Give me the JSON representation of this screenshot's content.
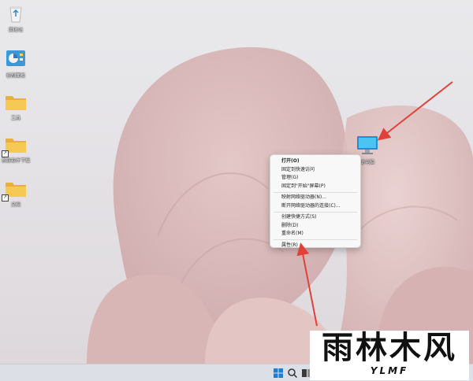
{
  "desktop": {
    "icons": [
      {
        "label": "回收站",
        "icon": "recycle-bin-icon"
      },
      {
        "label": "控制面板",
        "icon": "control-panel-icon"
      },
      {
        "label": "工具",
        "icon": "folder-icon"
      },
      {
        "label": "系统软件下载",
        "icon": "folder-icon"
      },
      {
        "label": "文档",
        "icon": "folder-icon"
      },
      {
        "label": "此电脑",
        "icon": "this-pc-icon"
      }
    ]
  },
  "context_menu": {
    "items": [
      {
        "label": "打开(O)",
        "bold": true
      },
      {
        "label": "固定到快速访问"
      },
      {
        "label": "管理(G)"
      },
      {
        "label": "固定到\"开始\"屏幕(P)"
      },
      {
        "label": "映射网络驱动器(N)..."
      },
      {
        "label": "断开网络驱动器的连接(C)..."
      },
      {
        "label": "创建快捷方式(S)"
      },
      {
        "label": "删除(D)"
      },
      {
        "label": "重命名(M)"
      },
      {
        "label": "属性(R)"
      }
    ]
  },
  "taskbar": {
    "items": [
      {
        "icon": "windows-start-icon"
      },
      {
        "icon": "search-icon"
      },
      {
        "icon": "task-view-icon"
      }
    ]
  },
  "watermark": {
    "text": "雨林木风",
    "subtext": "YLMF"
  },
  "colors": {
    "arrow": "#e0423a",
    "taskbar": "#dcdfe5",
    "folder": "#f2c14b",
    "monitor": "#29a8e0"
  }
}
